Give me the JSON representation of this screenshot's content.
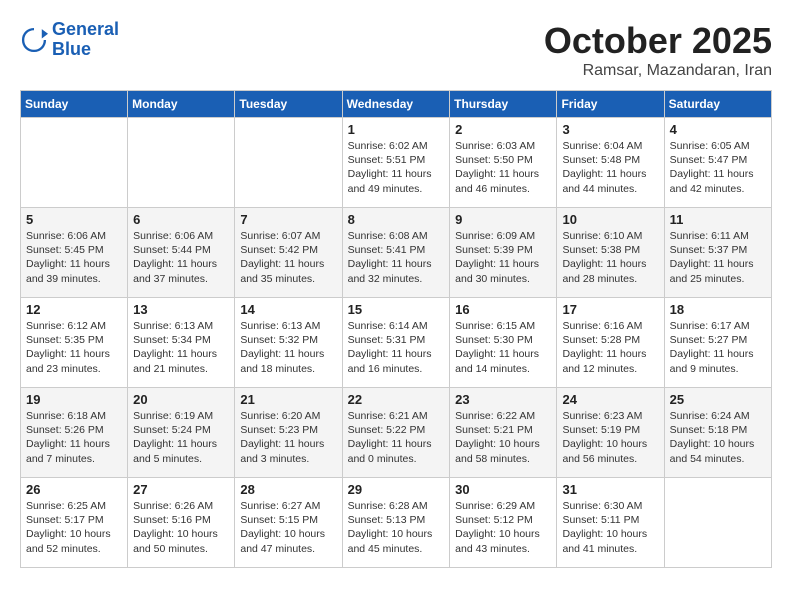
{
  "header": {
    "logo_line1": "General",
    "logo_line2": "Blue",
    "month": "October 2025",
    "location": "Ramsar, Mazandaran, Iran"
  },
  "days_of_week": [
    "Sunday",
    "Monday",
    "Tuesday",
    "Wednesday",
    "Thursday",
    "Friday",
    "Saturday"
  ],
  "weeks": [
    [
      {
        "day": "",
        "content": ""
      },
      {
        "day": "",
        "content": ""
      },
      {
        "day": "",
        "content": ""
      },
      {
        "day": "1",
        "content": "Sunrise: 6:02 AM\nSunset: 5:51 PM\nDaylight: 11 hours and 49 minutes."
      },
      {
        "day": "2",
        "content": "Sunrise: 6:03 AM\nSunset: 5:50 PM\nDaylight: 11 hours and 46 minutes."
      },
      {
        "day": "3",
        "content": "Sunrise: 6:04 AM\nSunset: 5:48 PM\nDaylight: 11 hours and 44 minutes."
      },
      {
        "day": "4",
        "content": "Sunrise: 6:05 AM\nSunset: 5:47 PM\nDaylight: 11 hours and 42 minutes."
      }
    ],
    [
      {
        "day": "5",
        "content": "Sunrise: 6:06 AM\nSunset: 5:45 PM\nDaylight: 11 hours and 39 minutes."
      },
      {
        "day": "6",
        "content": "Sunrise: 6:06 AM\nSunset: 5:44 PM\nDaylight: 11 hours and 37 minutes."
      },
      {
        "day": "7",
        "content": "Sunrise: 6:07 AM\nSunset: 5:42 PM\nDaylight: 11 hours and 35 minutes."
      },
      {
        "day": "8",
        "content": "Sunrise: 6:08 AM\nSunset: 5:41 PM\nDaylight: 11 hours and 32 minutes."
      },
      {
        "day": "9",
        "content": "Sunrise: 6:09 AM\nSunset: 5:39 PM\nDaylight: 11 hours and 30 minutes."
      },
      {
        "day": "10",
        "content": "Sunrise: 6:10 AM\nSunset: 5:38 PM\nDaylight: 11 hours and 28 minutes."
      },
      {
        "day": "11",
        "content": "Sunrise: 6:11 AM\nSunset: 5:37 PM\nDaylight: 11 hours and 25 minutes."
      }
    ],
    [
      {
        "day": "12",
        "content": "Sunrise: 6:12 AM\nSunset: 5:35 PM\nDaylight: 11 hours and 23 minutes."
      },
      {
        "day": "13",
        "content": "Sunrise: 6:13 AM\nSunset: 5:34 PM\nDaylight: 11 hours and 21 minutes."
      },
      {
        "day": "14",
        "content": "Sunrise: 6:13 AM\nSunset: 5:32 PM\nDaylight: 11 hours and 18 minutes."
      },
      {
        "day": "15",
        "content": "Sunrise: 6:14 AM\nSunset: 5:31 PM\nDaylight: 11 hours and 16 minutes."
      },
      {
        "day": "16",
        "content": "Sunrise: 6:15 AM\nSunset: 5:30 PM\nDaylight: 11 hours and 14 minutes."
      },
      {
        "day": "17",
        "content": "Sunrise: 6:16 AM\nSunset: 5:28 PM\nDaylight: 11 hours and 12 minutes."
      },
      {
        "day": "18",
        "content": "Sunrise: 6:17 AM\nSunset: 5:27 PM\nDaylight: 11 hours and 9 minutes."
      }
    ],
    [
      {
        "day": "19",
        "content": "Sunrise: 6:18 AM\nSunset: 5:26 PM\nDaylight: 11 hours and 7 minutes."
      },
      {
        "day": "20",
        "content": "Sunrise: 6:19 AM\nSunset: 5:24 PM\nDaylight: 11 hours and 5 minutes."
      },
      {
        "day": "21",
        "content": "Sunrise: 6:20 AM\nSunset: 5:23 PM\nDaylight: 11 hours and 3 minutes."
      },
      {
        "day": "22",
        "content": "Sunrise: 6:21 AM\nSunset: 5:22 PM\nDaylight: 11 hours and 0 minutes."
      },
      {
        "day": "23",
        "content": "Sunrise: 6:22 AM\nSunset: 5:21 PM\nDaylight: 10 hours and 58 minutes."
      },
      {
        "day": "24",
        "content": "Sunrise: 6:23 AM\nSunset: 5:19 PM\nDaylight: 10 hours and 56 minutes."
      },
      {
        "day": "25",
        "content": "Sunrise: 6:24 AM\nSunset: 5:18 PM\nDaylight: 10 hours and 54 minutes."
      }
    ],
    [
      {
        "day": "26",
        "content": "Sunrise: 6:25 AM\nSunset: 5:17 PM\nDaylight: 10 hours and 52 minutes."
      },
      {
        "day": "27",
        "content": "Sunrise: 6:26 AM\nSunset: 5:16 PM\nDaylight: 10 hours and 50 minutes."
      },
      {
        "day": "28",
        "content": "Sunrise: 6:27 AM\nSunset: 5:15 PM\nDaylight: 10 hours and 47 minutes."
      },
      {
        "day": "29",
        "content": "Sunrise: 6:28 AM\nSunset: 5:13 PM\nDaylight: 10 hours and 45 minutes."
      },
      {
        "day": "30",
        "content": "Sunrise: 6:29 AM\nSunset: 5:12 PM\nDaylight: 10 hours and 43 minutes."
      },
      {
        "day": "31",
        "content": "Sunrise: 6:30 AM\nSunset: 5:11 PM\nDaylight: 10 hours and 41 minutes."
      },
      {
        "day": "",
        "content": ""
      }
    ]
  ]
}
